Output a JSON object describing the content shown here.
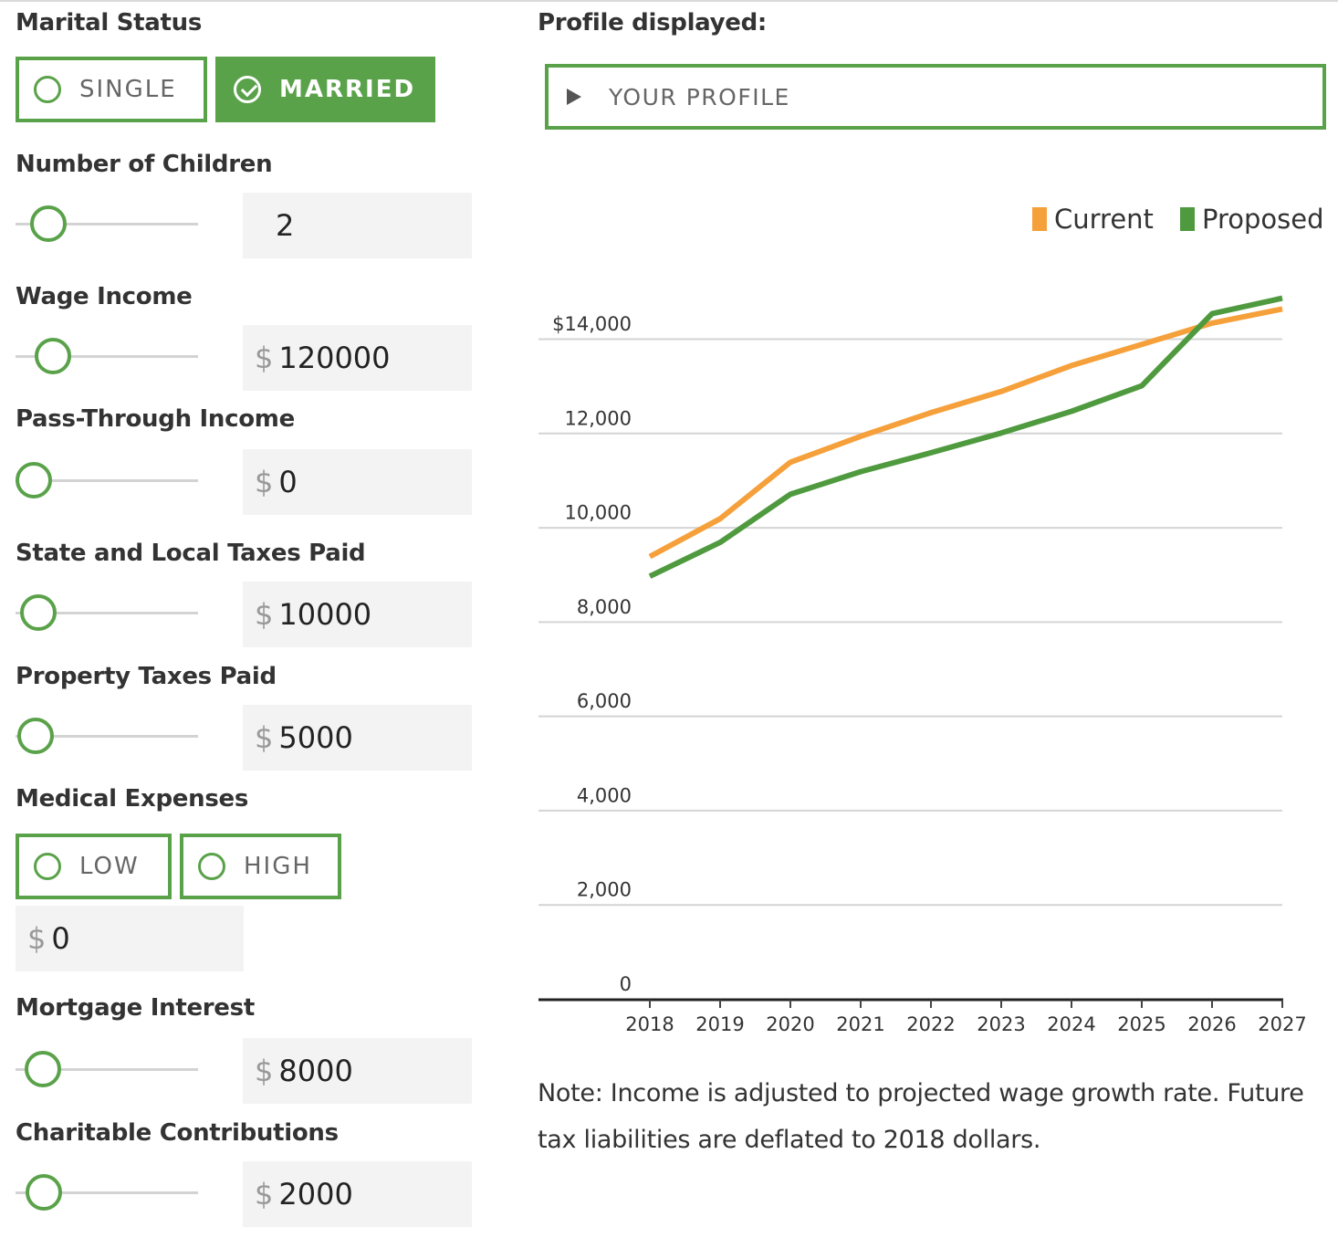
{
  "left": {
    "marital": {
      "label": "Marital Status",
      "options": [
        "SINGLE",
        "MARRIED"
      ],
      "selected": "MARRIED"
    },
    "children": {
      "label": "Number of Children",
      "value": "2",
      "slider_fraction": 0.1
    },
    "wage": {
      "label": "Wage Income",
      "currency": "$",
      "value": "120000",
      "slider_fraction": 0.13
    },
    "passthrough": {
      "label": "Pass-Through Income",
      "currency": "$",
      "value": "0",
      "slider_fraction": 0
    },
    "salt": {
      "label": "State and Local Taxes Paid",
      "currency": "$",
      "value": "10000",
      "slider_fraction": 0.03
    },
    "property": {
      "label": "Property Taxes Paid",
      "currency": "$",
      "value": "5000",
      "slider_fraction": 0.01
    },
    "medical": {
      "label": "Medical Expenses",
      "options": [
        "LOW",
        "HIGH"
      ],
      "currency": "$",
      "value": "0"
    },
    "mortgage": {
      "label": "Mortgage Interest",
      "currency": "$",
      "value": "8000",
      "slider_fraction": 0.06
    },
    "charity": {
      "label": "Charitable Contributions",
      "currency": "$",
      "value": "2000",
      "slider_fraction": 0.07
    }
  },
  "right": {
    "profile_label": "Profile displayed:",
    "profile_selected": "YOUR PROFILE",
    "note": "Note: Income is adjusted to projected wage growth rate. Future tax liabilities are deflated to 2018 dollars."
  },
  "colors": {
    "accent": "#5aa24a",
    "current": "#f5a03a",
    "proposed": "#4f9a3f"
  },
  "icons": {
    "radio": "radio-circle-icon",
    "check": "check-circle-icon",
    "expand": "triangle-right-icon"
  },
  "chart_data": {
    "type": "line",
    "x": [
      2018,
      2019,
      2020,
      2021,
      2022,
      2023,
      2024,
      2025,
      2026,
      2027
    ],
    "series": [
      {
        "name": "Current",
        "values": [
          9400,
          10200,
          11400,
          11950,
          12450,
          12900,
          13450,
          13900,
          14350,
          14650
        ]
      },
      {
        "name": "Proposed",
        "values": [
          8980,
          9700,
          10720,
          11200,
          11600,
          12020,
          12480,
          13020,
          14550,
          14880
        ]
      }
    ],
    "yticks": [
      "0",
      "2,000",
      "4,000",
      "6,000",
      "8,000",
      "10,000",
      "12,000",
      "$14,000"
    ],
    "ylim": [
      0,
      14000
    ],
    "xlim": [
      2018,
      2027
    ],
    "grid": true,
    "legend": "top-right"
  }
}
